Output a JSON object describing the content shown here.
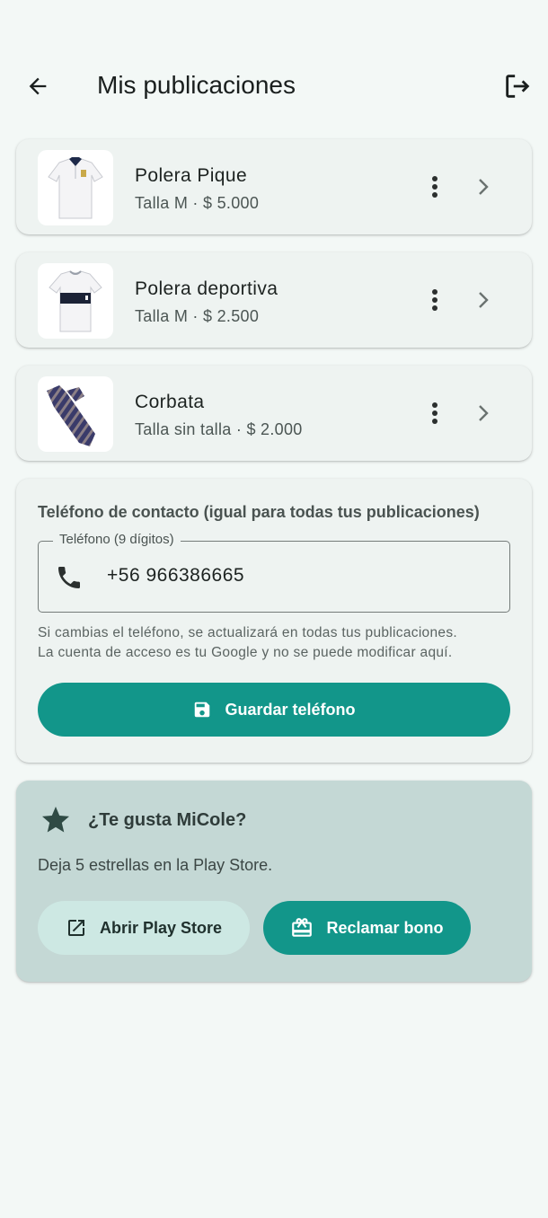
{
  "header": {
    "title": "Mis publicaciones",
    "back_icon": "arrow-back-icon",
    "logout_icon": "logout-icon"
  },
  "listings": [
    {
      "name": "Polera Pique",
      "detail": "Talla M · $ 5.000",
      "image": "white-polo-shirt"
    },
    {
      "name": "Polera deportiva",
      "detail": "Talla M · $ 2.500",
      "image": "white-sport-shirt"
    },
    {
      "name": "Corbata",
      "detail": "Talla sin talla · $ 2.000",
      "image": "striped-tie"
    }
  ],
  "contact": {
    "heading": "Teléfono de contacto (igual para todas tus publicaciones)",
    "field_label": "Teléfono (9 dígitos)",
    "phone_value": "+56 966386665",
    "help_line1": "Si cambias el teléfono, se actualizará en todas tus publicaciones.",
    "help_line2": "La cuenta de acceso es tu Google y no se puede modificar aquí.",
    "save_label": "Guardar teléfono"
  },
  "rating": {
    "title": "¿Te gusta MiCole?",
    "text": "Deja 5 estrellas en la Play Store.",
    "open_store_label": "Abrir Play Store",
    "claim_label": "Reclamar bono"
  },
  "colors": {
    "background": "#f3f8f6",
    "card": "#eef3f1",
    "accent": "#12968a",
    "rating_card": "#c4d8d5",
    "tonal_button": "#cde8e3"
  }
}
